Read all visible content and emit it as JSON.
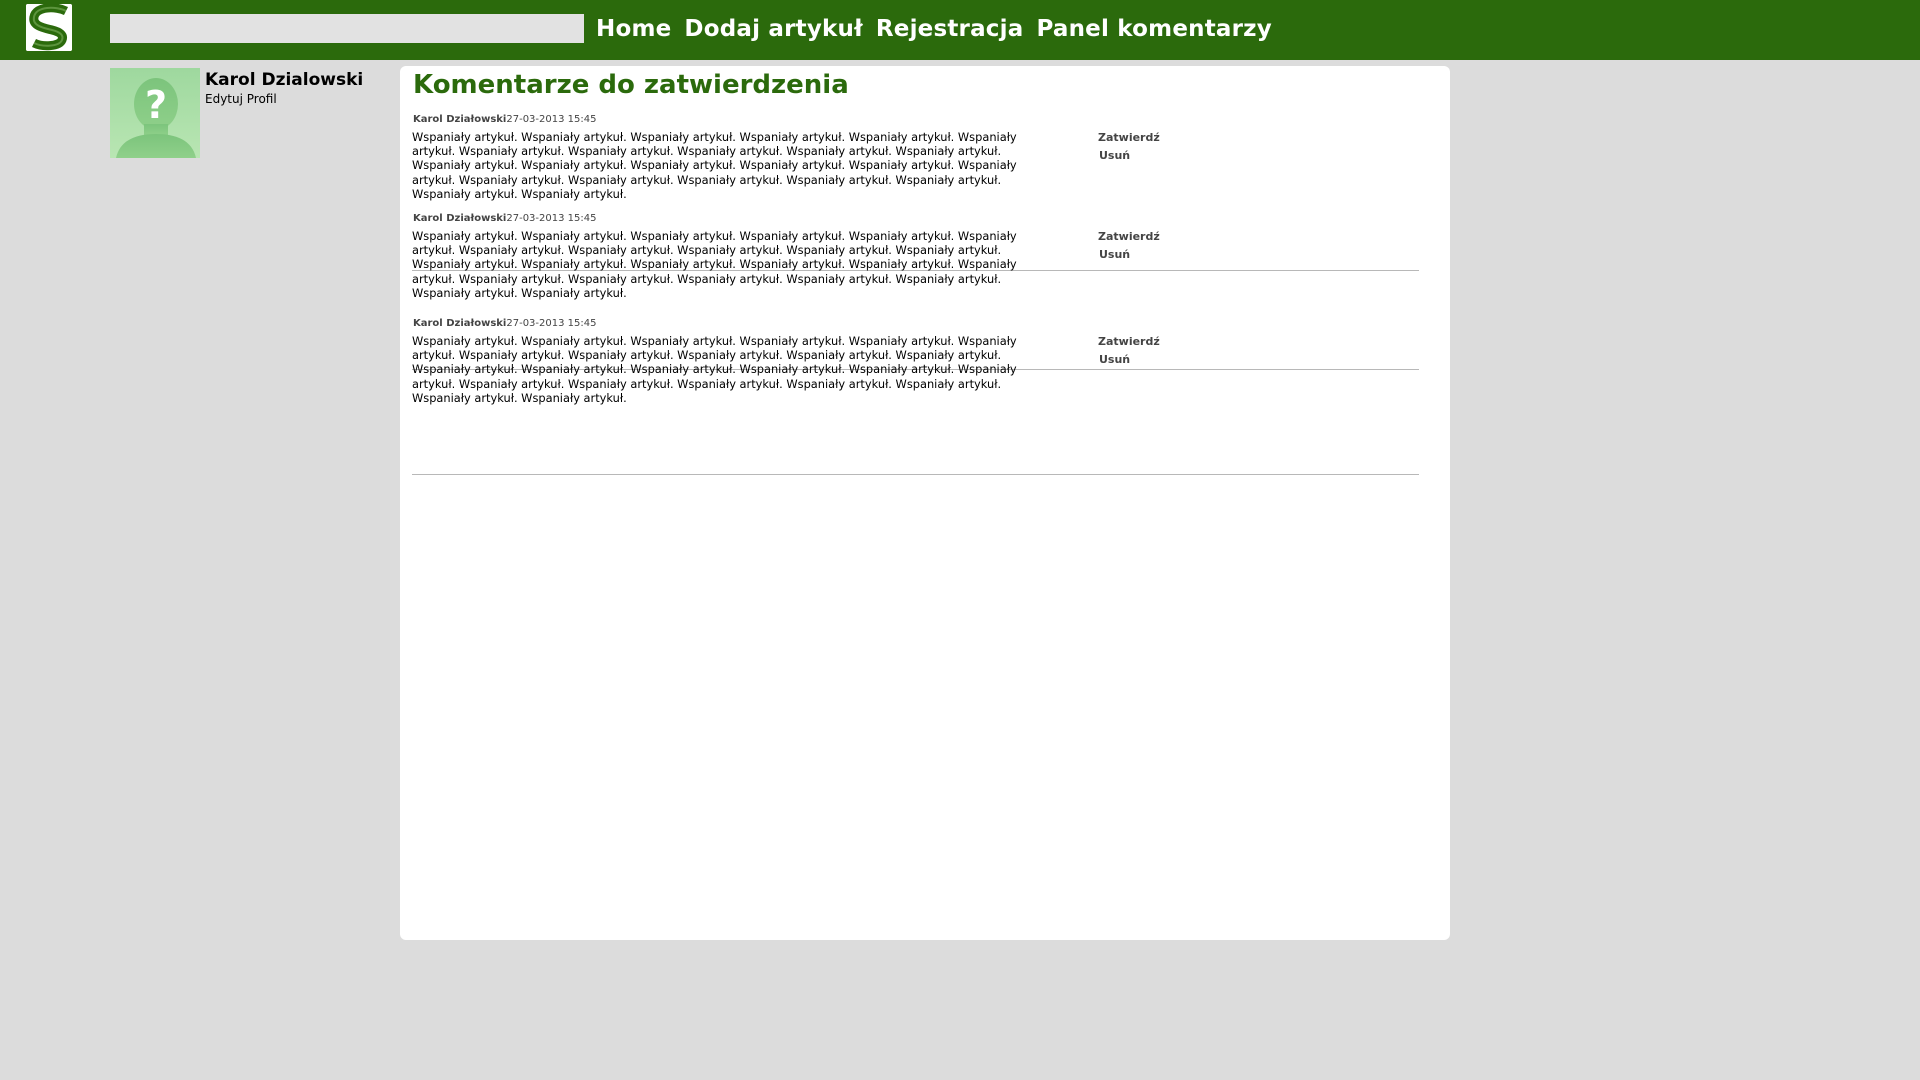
{
  "header": {
    "logo_letter": "S",
    "search": {
      "value": "",
      "placeholder": ""
    },
    "nav": [
      {
        "label": "Home"
      },
      {
        "label": "Dodaj artykuł"
      },
      {
        "label": "Rejestracja"
      },
      {
        "label": "Panel komentarzy"
      }
    ],
    "colors": {
      "bar": "#2b6a0c",
      "nav_text": "#ffffff"
    }
  },
  "profile": {
    "name": "Karol Dzialowski",
    "edit_label": "Edytuj Profil",
    "avatar_icon": "unknown-user-icon"
  },
  "main": {
    "title": "Komentarze do zatwierdzenia",
    "comments": [
      {
        "author": "Karol Działowski",
        "date": "27-03-2013 15:45",
        "text": "Wspaniały artykuł. Wspaniały artykuł. Wspaniały artykuł. Wspaniały artykuł. Wspaniały artykuł. Wspaniały artykuł. Wspaniały artykuł. Wspaniały artykuł. Wspaniały artykuł. Wspaniały artykuł. Wspaniały artykuł. Wspaniały artykuł. Wspaniały artykuł. Wspaniały artykuł. Wspaniały artykuł. Wspaniały artykuł. Wspaniały artykuł. Wspaniały artykuł. Wspaniały artykuł. Wspaniały artykuł. Wspaniały artykuł. Wspaniały artykuł. Wspaniały artykuł. Wspaniały artykuł.",
        "approve_label": "Zatwierdź",
        "delete_label": "Usuń"
      },
      {
        "author": "Karol Działowski",
        "date": "27-03-2013 15:45",
        "text": "Wspaniały artykuł. Wspaniały artykuł. Wspaniały artykuł. Wspaniały artykuł. Wspaniały artykuł. Wspaniały artykuł. Wspaniały artykuł. Wspaniały artykuł. Wspaniały artykuł. Wspaniały artykuł. Wspaniały artykuł. Wspaniały artykuł. Wspaniały artykuł. Wspaniały artykuł. Wspaniały artykuł. Wspaniały artykuł. Wspaniały artykuł. Wspaniały artykuł. Wspaniały artykuł. Wspaniały artykuł. Wspaniały artykuł. Wspaniały artykuł. Wspaniały artykuł. Wspaniały artykuł.",
        "approve_label": "Zatwierdź",
        "delete_label": "Usuń"
      },
      {
        "author": "Karol Działowski",
        "date": "27-03-2013 15:45",
        "text": "Wspaniały artykuł. Wspaniały artykuł. Wspaniały artykuł. Wspaniały artykuł. Wspaniały artykuł. Wspaniały artykuł. Wspaniały artykuł. Wspaniały artykuł. Wspaniały artykuł. Wspaniały artykuł. Wspaniały artykuł. Wspaniały artykuł. Wspaniały artykuł. Wspaniały artykuł. Wspaniały artykuł. Wspaniały artykuł. Wspaniały artykuł. Wspaniały artykuł. Wspaniały artykuł. Wspaniały artykuł. Wspaniały artykuł. Wspaniały artykuł. Wspaniały artykuł. Wspaniały artykuł.",
        "approve_label": "Zatwierdź",
        "delete_label": "Usuń"
      }
    ]
  }
}
